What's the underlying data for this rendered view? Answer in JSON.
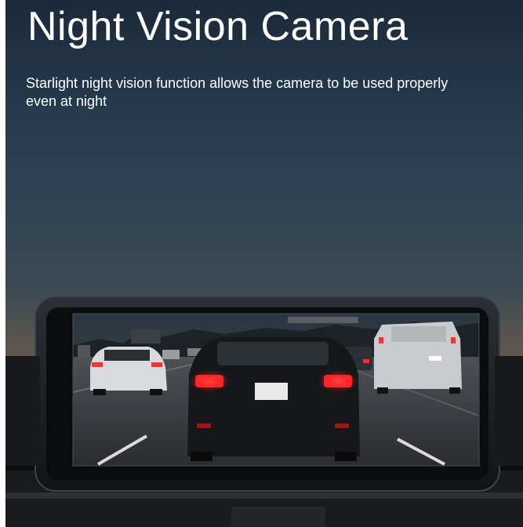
{
  "headline": "Night Vision Camera",
  "description": "Starlight night vision function allows the camera to be used properly even at night",
  "colors": {
    "sky_top": "#1b2a3a",
    "sky_mid": "#2f4455",
    "horizon_glow": "#6a5a4c",
    "text": "#ffffff",
    "tail_light": "#ff2a2a"
  }
}
